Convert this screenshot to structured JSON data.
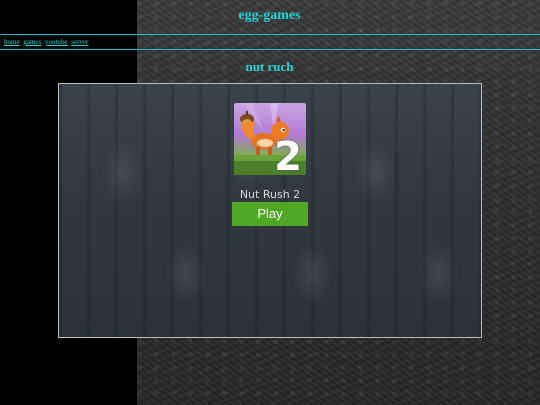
{
  "header": {
    "site_title": "egg-games"
  },
  "nav": {
    "links": [
      "home",
      "games",
      "youtube",
      "server"
    ]
  },
  "page": {
    "heading": "nut ruch"
  },
  "game": {
    "title": "Nut Rush 2",
    "play_label": "Play",
    "thumbnail_badge": "2",
    "thumbnail_icon": "squirrel-acorn-icon"
  },
  "colors": {
    "accent": "#22d3d3",
    "play_button": "#4fa825",
    "sidebar": "#000000"
  }
}
